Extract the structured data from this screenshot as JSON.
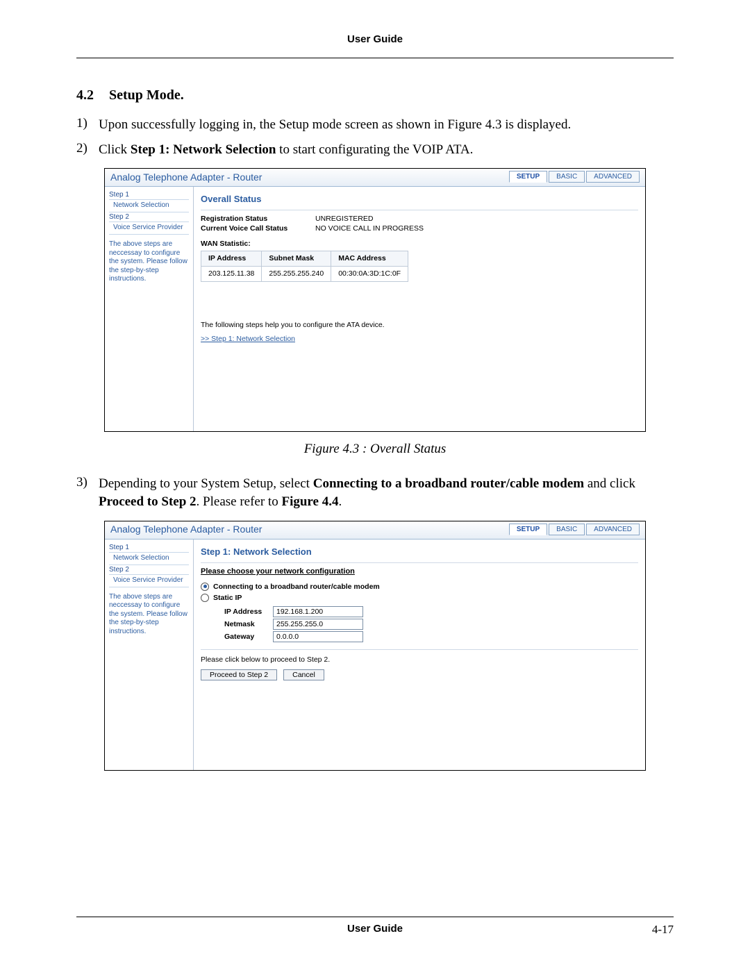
{
  "doc": {
    "header": "User Guide",
    "footer_title": "User Guide",
    "page_number": "4-17",
    "section_number": "4.2",
    "section_title": "Setup Mode.",
    "steps": {
      "s1_marker": "1)",
      "s1_text": "Upon successfully logging in, the Setup mode screen as shown in Figure 4.3 is displayed.",
      "s2_marker": "2)",
      "s2_prefix": "Click ",
      "s2_bold": "Step 1: Network Selection",
      "s2_suffix": " to start configurating the VOIP ATA.",
      "s3_marker": "3)",
      "s3_a": "Depending to your System Setup, select ",
      "s3_b": "Connecting to a broadband router/cable modem",
      "s3_c": " and click ",
      "s3_d": "Proceed to Step 2",
      "s3_e": ". Please refer to ",
      "s3_f": "Figure 4.4",
      "s3_g": "."
    },
    "figure1_caption": "Figure 4.3 : Overall Status"
  },
  "shot1": {
    "title": "Analog Telephone Adapter - Router",
    "tabs": {
      "setup": "SETUP",
      "basic": "BASIC",
      "advanced": "ADVANCED"
    },
    "side": {
      "step1": "Step 1",
      "step1_link": "Network Selection",
      "step2": "Step 2",
      "step2_link": "Voice Service Provider",
      "note": "The above steps are neccessay to configure the system. Please follow the step-by-step instructions."
    },
    "main": {
      "heading": "Overall Status",
      "reg_k": "Registration Status",
      "reg_v": "UNREGISTERED",
      "call_k": "Current Voice Call Status",
      "call_v": "NO VOICE CALL IN PROGRESS",
      "wan_title": "WAN Statistic:",
      "th_ip": "IP Address",
      "th_mask": "Subnet Mask",
      "th_mac": "MAC Address",
      "td_ip": "203.125.11.38",
      "td_mask": "255.255.255.240",
      "td_mac": "00:30:0A:3D:1C:0F",
      "help": "The following steps help you to configure the ATA device.",
      "wizard_link": ">> Step 1: Network Selection"
    }
  },
  "shot2": {
    "title": "Analog Telephone Adapter - Router",
    "tabs": {
      "setup": "SETUP",
      "basic": "BASIC",
      "advanced": "ADVANCED"
    },
    "side": {
      "step1": "Step 1",
      "step1_link": "Network Selection",
      "step2": "Step 2",
      "step2_link": "Voice Service Provider",
      "note": "The above steps are neccessay to configure the system. Please follow the step-by-step instructions."
    },
    "main": {
      "heading": "Step 1: Network Selection",
      "choose": "Please choose your network configuration",
      "opt1": "Connecting to a broadband router/cable modem",
      "opt2": "Static IP",
      "ip_lbl": "IP Address",
      "ip_val": "192.168.1.200",
      "mask_lbl": "Netmask",
      "mask_val": "255.255.255.0",
      "gw_lbl": "Gateway",
      "gw_val": "0.0.0.0",
      "proceed_note": "Please click below to proceed to Step 2.",
      "btn_proceed": "Proceed to Step 2",
      "btn_cancel": "Cancel"
    }
  }
}
